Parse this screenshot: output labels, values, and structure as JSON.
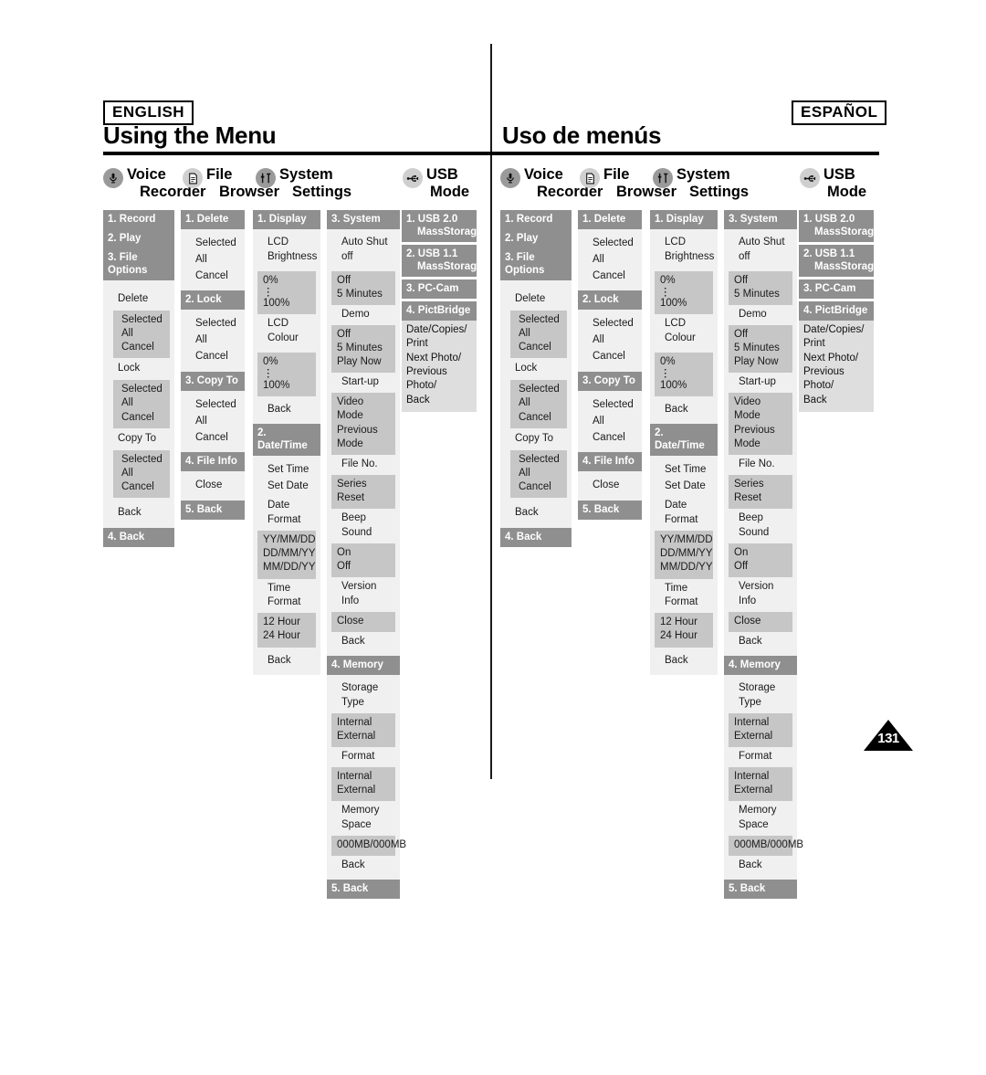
{
  "page": {
    "number": "131"
  },
  "sections": [
    {
      "id": "en",
      "lang_tag": "ENGLISH",
      "title": "Using the Menu"
    },
    {
      "id": "es",
      "lang_tag": "ESPAÑOL",
      "title": "Uso de menús"
    }
  ],
  "groups": {
    "voice": {
      "line1": "Voice",
      "line2": "Recorder",
      "icon": "microphone-icon"
    },
    "file": {
      "line1": "File",
      "line2": "Browser",
      "icon": "document-icon"
    },
    "system": {
      "line1": "System",
      "line2": "Settings",
      "icon": "sliders-icon"
    },
    "usb": {
      "line1": "USB",
      "line2": "Mode",
      "icon": "usb-icon"
    }
  },
  "columns": {
    "voice": {
      "h1": "1. Record",
      "h2": "2. Play",
      "h3": "3. File Options",
      "delete_label": "Delete",
      "delete_opts": [
        "Selected",
        "All",
        "Cancel"
      ],
      "lock_label": "Lock",
      "lock_opts": [
        "Selected",
        "All",
        "Cancel"
      ],
      "copyto_label": "Copy To",
      "copyto_opts": [
        "Selected",
        "All",
        "Cancel"
      ],
      "back": "Back",
      "h4": "4. Back"
    },
    "file": {
      "h1": "1. Delete",
      "delete_opts": [
        "Selected",
        "All",
        "Cancel"
      ],
      "h2": "2. Lock",
      "lock_opts": [
        "Selected",
        "All",
        "Cancel"
      ],
      "h3": "3. Copy To",
      "copyto_opts": [
        "Selected",
        "All",
        "Cancel"
      ],
      "h4": "4. File Info",
      "close": "Close",
      "h5": "5. Back"
    },
    "display": {
      "h1": "1. Display",
      "lcd_brightness": [
        "LCD",
        "Brightness"
      ],
      "brightness_range": [
        "0%",
        "100%"
      ],
      "lcd_colour": "LCD Colour",
      "colour_range": [
        "0%",
        "100%"
      ],
      "back": "Back",
      "h2": "2. Date/Time",
      "set_time": "Set Time",
      "set_date": "Set Date",
      "date_format_label": "Date Format",
      "date_formats": [
        "YY/MM/DD",
        "DD/MM/YY",
        "MM/DD/YY"
      ],
      "time_format_label": "Time Format",
      "time_formats": [
        "12 Hour",
        "24 Hour"
      ],
      "back2": "Back"
    },
    "system": {
      "h3": "3. System",
      "auto_shut_off": [
        "Auto Shut",
        "off"
      ],
      "auto_shut_opts": [
        "Off",
        "5 Minutes"
      ],
      "demo_label": "Demo",
      "demo_opts": [
        "Off",
        "5 Minutes",
        "Play Now"
      ],
      "startup_label": "Start-up",
      "startup_opts": [
        "Video Mode",
        "Previous",
        "Mode"
      ],
      "fileno_label": "File No.",
      "fileno_opts": [
        "Series",
        "Reset"
      ],
      "beep_label": "Beep Sound",
      "beep_opts": [
        "On",
        "Off"
      ],
      "version_label": "Version Info",
      "version_opts": [
        "Close"
      ],
      "back": "Back",
      "h4": "4. Memory",
      "storage_label": "Storage Type",
      "storage_opts": [
        "Internal",
        "External"
      ],
      "format_label": "Format",
      "format_opts": [
        "Internal",
        "External"
      ],
      "memspace_label": "Memory Space",
      "memspace_value": "000MB/000MB",
      "back2": "Back",
      "h5": "5. Back"
    },
    "usb": {
      "t1": [
        "1. USB 2.0",
        "MassStorage"
      ],
      "t2": [
        "2. USB 1.1",
        "MassStorage"
      ],
      "t3": "3. PC-Cam",
      "t4": "4. PictBridge",
      "pictbridge_lines": [
        "Date/Copies/",
        "Print",
        "Next Photo/",
        "Previous Photo/",
        "Back"
      ]
    }
  }
}
